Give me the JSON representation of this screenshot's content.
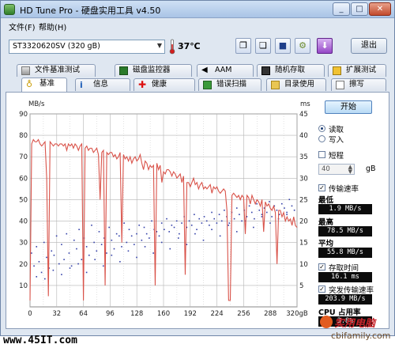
{
  "app": {
    "title": "HD Tune Pro - 硬盘实用工具 v4.50"
  },
  "window_controls": {
    "minimize": "_",
    "maximize": "□",
    "close": "✕"
  },
  "menu": {
    "items": [
      "文件(F)",
      "帮助(H)"
    ]
  },
  "toolbar": {
    "drive": "ST3320620SV (320 gB)",
    "temperature": "37℃",
    "exit_label": "退出",
    "icons": [
      "copy-info-icon",
      "copy-text-icon",
      "save-icon",
      "options-icon",
      "down-arrow-icon"
    ]
  },
  "tabs_top": [
    {
      "label": "文件基准测试",
      "icon": "file-benchmark-icon"
    },
    {
      "label": "磁盘监控器",
      "icon": "disk-monitor-icon"
    },
    {
      "label": "AAM",
      "icon": "speaker-icon"
    },
    {
      "label": "随机存取",
      "icon": "random-access-icon"
    },
    {
      "label": "扩展测试",
      "icon": "extra-tests-icon"
    }
  ],
  "tabs_bottom": [
    {
      "label": "基准",
      "icon": "benchmark-icon",
      "active": true
    },
    {
      "label": "信息",
      "icon": "info-icon"
    },
    {
      "label": "健康",
      "icon": "health-icon"
    },
    {
      "label": "错误扫描",
      "icon": "error-scan-icon"
    },
    {
      "label": "目录使用",
      "icon": "folder-usage-icon"
    },
    {
      "label": "擦写",
      "icon": "erase-icon"
    }
  ],
  "side": {
    "start_label": "开始",
    "read_label": "读取",
    "write_label": "写入",
    "short_label": "短程",
    "short_value": "40",
    "short_unit": "gB",
    "transfer_label": "传输速率",
    "min_label": "最低",
    "min_value": "1.9 MB/s",
    "max_label": "最高",
    "max_value": "78.5 MB/s",
    "avg_label": "平均",
    "avg_value": "55.8 MB/s",
    "access_label": "存取时间",
    "access_value": "16.1 ms",
    "burst_label": "突发传输速率",
    "burst_value": "203.9 MB/s",
    "cpu_label": "CPU 占用率",
    "cpu_value": "3.8%"
  },
  "footer": {
    "site": "www.45IT.com",
    "logo_cn": "实用电脑",
    "logo_en": "cbifamily.com"
  },
  "colors": {
    "transfer": "#d9534a",
    "access": "#3340a8",
    "grid": "#b5b5b5"
  },
  "chart_data": {
    "type": "line",
    "y_left_label": "MB/s",
    "y_right_label": "ms",
    "ylim_left": [
      0,
      90
    ],
    "ylim_right": [
      0,
      45
    ],
    "y_left_ticks": [
      90,
      80,
      70,
      60,
      50,
      40,
      30,
      20,
      10
    ],
    "y_right_ticks": [
      45,
      40,
      35,
      30,
      25,
      20,
      15,
      10,
      5
    ],
    "x_ticks": [
      "0",
      "32",
      "64",
      "96",
      "128",
      "160",
      "192",
      "224",
      "256",
      "288",
      "320gB"
    ],
    "xlim": [
      0,
      320
    ],
    "series": [
      {
        "name": "传输速率",
        "axis": "left",
        "x": [
          0,
          2,
          4,
          6,
          8,
          10,
          12,
          14,
          16,
          18,
          20,
          22,
          24,
          26,
          28,
          30,
          32,
          34,
          36,
          38,
          40,
          42,
          44,
          46,
          48,
          50,
          52,
          54,
          56,
          58,
          60,
          62,
          64,
          66,
          68,
          70,
          72,
          74,
          76,
          78,
          80,
          82,
          84,
          86,
          88,
          90,
          92,
          94,
          96,
          98,
          100,
          102,
          104,
          106,
          108,
          110,
          112,
          114,
          116,
          118,
          120,
          122,
          124,
          126,
          128,
          130,
          132,
          134,
          136,
          138,
          140,
          142,
          144,
          146,
          148,
          150,
          152,
          154,
          156,
          158,
          160,
          162,
          164,
          166,
          168,
          170,
          172,
          174,
          176,
          178,
          180,
          182,
          184,
          186,
          188,
          190,
          192,
          194,
          196,
          198,
          200,
          202,
          204,
          206,
          208,
          210,
          212,
          214,
          216,
          218,
          220,
          222,
          224,
          226,
          228,
          230,
          232,
          234,
          236,
          238,
          240,
          242,
          244,
          246,
          248,
          250,
          252,
          254,
          256,
          258,
          260,
          262,
          264,
          266,
          268,
          270,
          272,
          274,
          276,
          278,
          280,
          282,
          284,
          286,
          288,
          290,
          292,
          294,
          296,
          298,
          300,
          302,
          304,
          306,
          308,
          310,
          312,
          314,
          316,
          318,
          320
        ],
        "values": [
          3,
          76,
          78,
          77,
          77,
          78,
          76,
          75,
          76,
          77,
          60,
          5,
          77,
          76,
          75,
          76,
          76,
          75,
          76,
          76,
          75,
          76,
          73,
          76,
          75,
          76,
          74,
          76,
          75,
          73,
          75,
          76,
          3,
          74,
          75,
          73,
          74,
          74,
          72,
          73,
          74,
          71,
          50,
          72,
          73,
          10,
          72,
          71,
          72,
          72,
          70,
          71,
          69,
          70,
          72,
          30,
          71,
          69,
          70,
          68,
          70,
          67,
          69,
          70,
          68,
          69,
          71,
          67,
          64,
          68,
          67,
          64,
          66,
          65,
          66,
          10,
          67,
          64,
          66,
          58,
          63,
          62,
          64,
          64,
          63,
          61,
          63,
          62,
          60,
          61,
          62,
          58,
          61,
          15,
          58,
          58,
          56,
          58,
          60,
          57,
          58,
          55,
          57,
          58,
          55,
          56,
          55,
          56,
          57,
          53,
          56,
          55,
          56,
          54,
          53,
          54,
          55,
          54,
          45,
          3,
          3,
          52,
          53,
          52,
          51,
          52,
          50,
          52,
          51,
          34,
          52,
          51,
          48,
          52,
          50,
          48,
          50,
          49,
          47,
          50,
          35,
          49,
          47,
          48,
          46,
          45,
          47,
          44,
          20,
          45,
          45,
          42,
          44,
          40,
          42,
          40,
          41,
          38,
          42,
          38,
          37
        ]
      },
      {
        "name": "存取时间",
        "axis": "right",
        "style": "scatter",
        "x": [
          2,
          5,
          8,
          11,
          14,
          17,
          20,
          23,
          26,
          29,
          32,
          35,
          38,
          41,
          44,
          47,
          50,
          53,
          56,
          59,
          62,
          65,
          68,
          71,
          74,
          77,
          80,
          83,
          86,
          89,
          92,
          95,
          98,
          101,
          104,
          107,
          110,
          113,
          116,
          119,
          122,
          125,
          128,
          131,
          134,
          137,
          140,
          143,
          146,
          149,
          152,
          155,
          158,
          161,
          164,
          167,
          170,
          173,
          176,
          179,
          182,
          185,
          188,
          191,
          194,
          197,
          200,
          203,
          206,
          209,
          212,
          215,
          218,
          221,
          224,
          227,
          230,
          233,
          236,
          239,
          242,
          245,
          248,
          251,
          254,
          257,
          260,
          263,
          266,
          269,
          272,
          275,
          278,
          281,
          284,
          287,
          290,
          293,
          296,
          299,
          302,
          305,
          308,
          311,
          314,
          317,
          8,
          18,
          28,
          38,
          48,
          58,
          68,
          78,
          88,
          98,
          108,
          118,
          128,
          138,
          148,
          158,
          168,
          178,
          188,
          198,
          208,
          218,
          228,
          238,
          248,
          258,
          268,
          278,
          288,
          298,
          308
        ],
        "values": [
          12.5,
          9.5,
          14.0,
          10.5,
          8.0,
          15.0,
          11.5,
          9.0,
          13.0,
          12.0,
          16.5,
          10.0,
          14.5,
          11.0,
          17.0,
          12.5,
          9.5,
          15.5,
          13.5,
          18.0,
          11.0,
          16.0,
          14.0,
          12.0,
          19.0,
          15.0,
          13.0,
          17.5,
          14.5,
          16.0,
          12.5,
          18.5,
          15.5,
          13.5,
          17.0,
          16.5,
          14.0,
          19.5,
          15.0,
          18.0,
          16.5,
          14.5,
          17.0,
          19.0,
          15.5,
          18.5,
          17.0,
          16.0,
          20.0,
          18.0,
          17.5,
          16.5,
          19.5,
          18.0,
          20.5,
          17.5,
          19.0,
          18.5,
          20.0,
          17.0,
          19.5,
          21.0,
          18.5,
          20.0,
          19.0,
          21.5,
          18.0,
          20.5,
          19.5,
          21.0,
          20.0,
          19.0,
          22.0,
          20.5,
          19.5,
          21.5,
          20.0,
          22.5,
          21.0,
          19.5,
          22.0,
          20.5,
          23.0,
          21.5,
          20.0,
          22.5,
          21.0,
          23.5,
          22.0,
          20.5,
          24.0,
          22.5,
          21.5,
          23.0,
          22.0,
          24.5,
          21.0,
          23.5,
          22.5,
          21.5,
          24.0,
          23.0,
          22.0,
          25.0,
          23.5,
          22.5,
          7.0,
          6.5,
          8.5,
          7.5,
          9.0,
          10.0,
          8.0,
          11.0,
          9.5,
          12.0,
          10.5,
          13.0,
          11.5,
          14.0,
          12.5,
          15.0,
          13.5,
          16.0,
          14.5,
          17.0,
          15.5,
          18.0,
          16.5,
          19.0,
          17.5,
          20.0,
          18.5,
          21.0,
          19.5,
          20.5,
          21.5
        ]
      }
    ]
  }
}
